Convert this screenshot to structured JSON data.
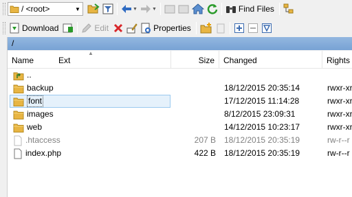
{
  "toolbar1": {
    "directory_combo": {
      "value": "/ <root>"
    },
    "find_files_label": "Find Files"
  },
  "toolbar2": {
    "download_label": "Download",
    "edit_label": "Edit",
    "properties_label": "Properties"
  },
  "path_bar": {
    "path": "/"
  },
  "columns": {
    "name": "Name",
    "ext": "Ext",
    "size": "Size",
    "changed": "Changed",
    "rights": "Rights"
  },
  "files": [
    {
      "name": "..",
      "type": "parent",
      "size": "",
      "changed": "",
      "rights": ""
    },
    {
      "name": "backup",
      "type": "folder",
      "size": "",
      "changed": "18/12/2015 20:35:14",
      "rights": "rwxr-xr"
    },
    {
      "name": "font",
      "type": "folder",
      "size": "",
      "changed": "17/12/2015 11:14:28",
      "rights": "rwxr-xr"
    },
    {
      "name": "images",
      "type": "folder",
      "size": "",
      "changed": "8/12/2015 23:09:31",
      "rights": "rwxr-xr"
    },
    {
      "name": "web",
      "type": "folder",
      "size": "",
      "changed": "14/12/2015 10:23:17",
      "rights": "rwxr-xr"
    },
    {
      "name": ".htaccess",
      "type": "file-hidden",
      "size": "207 B",
      "changed": "18/12/2015 20:35:19",
      "rights": "rw-r--r"
    },
    {
      "name": "index.php",
      "type": "file",
      "size": "422 B",
      "changed": "18/12/2015 20:35:19",
      "rights": "rw-r--r"
    }
  ],
  "selected_index": 2,
  "colors": {
    "path_bar": "#86acdb",
    "selection_fill": "#e5f1fb",
    "selection_border": "#99c9ef",
    "folder": "#e8b543"
  }
}
